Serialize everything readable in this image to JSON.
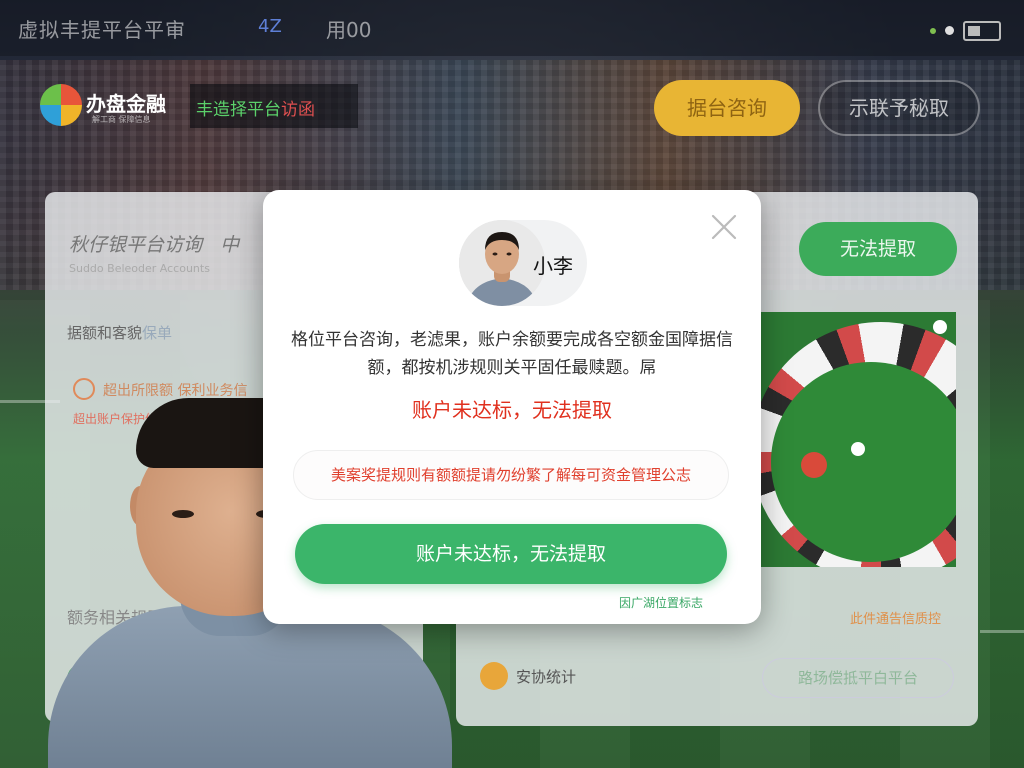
{
  "topbar": {
    "title": "虚拟丰提平台平审",
    "mid_code": "4Z",
    "mid_label": "用00"
  },
  "header": {
    "logo_text": "办盘金融",
    "logo_sub": "解工商 保障信息",
    "banner_green": "丰造择平台",
    "banner_red": "访函",
    "btn_gold": "据台咨询",
    "btn_outline": "示联予秘取"
  },
  "card_left": {
    "title": "秋仔银平台访询",
    "title_suffix": "中",
    "subtitle": "Suddo Beleoder Accounts",
    "row1": "据额和客貌",
    "row1_suffix": "保单",
    "warn_line1": "超出所限额 保利业务信",
    "warn_line2": "超出账户保护信",
    "related": "额务相关规则",
    "plus": "+"
  },
  "card_right": {
    "btn_green": "无法提取",
    "orange_text": "此件通告信质控",
    "coin_label": "安协统计",
    "pill": "路场偿抵平白平台"
  },
  "modal": {
    "avatar_name": "小李",
    "body": "格位平台咨询，老滤果，账户余额要完成各空额金国障据信额，都按机涉规则关平固任最赎题。屌",
    "alert": "账户未达标，无法提取",
    "notice": "美案奖提规则有额额提请勿纷繁了解每可资金管理公志",
    "primary_button": "账户未达标，无法提取",
    "footer_link": "因广湖位置标志"
  },
  "colors": {
    "primary_green": "#3bb56a",
    "alert_red": "#e0301e",
    "gold": "#e8b534"
  }
}
